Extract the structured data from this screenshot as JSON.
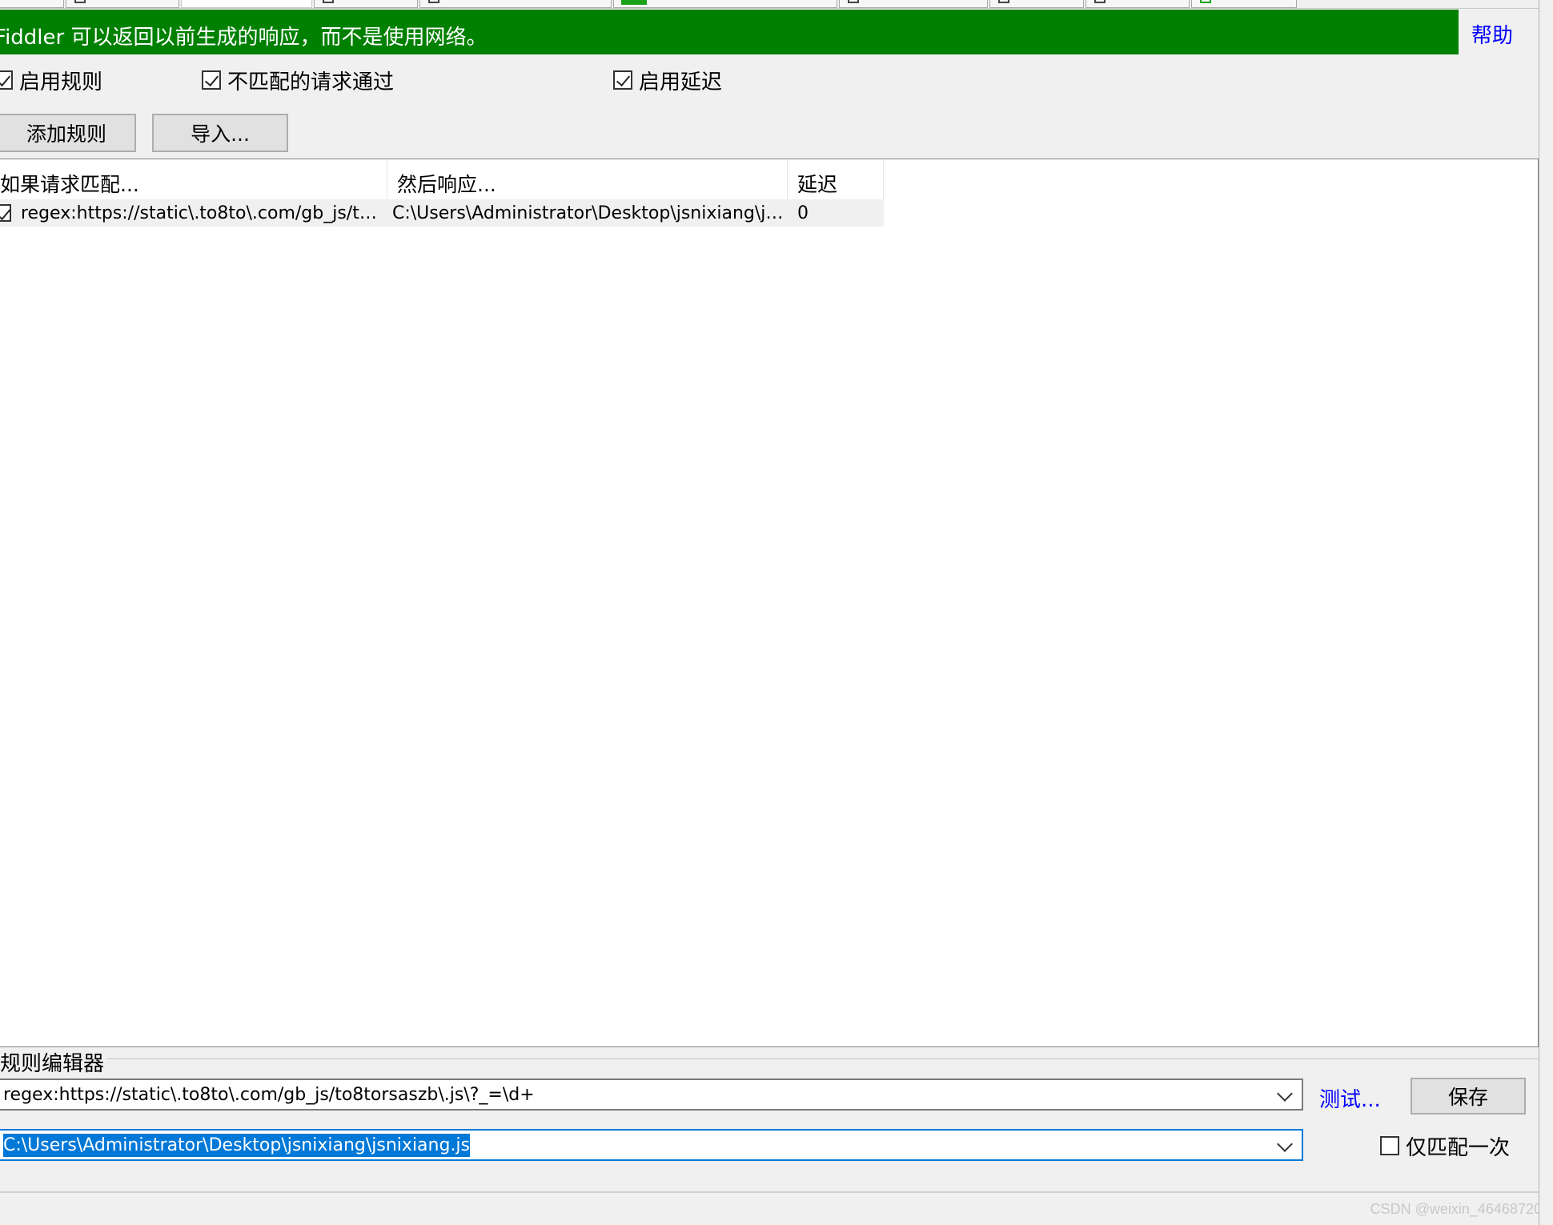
{
  "banner": {
    "message": "Fiddler 可以返回以前生成的响应，而不是使用网络。",
    "help_label": "帮助",
    "bg_color": "#008000"
  },
  "options": {
    "enable_rules": {
      "label": "启用规则",
      "checked": true
    },
    "unmatched_passthrough": {
      "label": "不匹配的请求通过",
      "checked": true
    },
    "enable_latency": {
      "label": "启用延迟",
      "checked": true
    }
  },
  "toolbar": {
    "add_rule_label": "添加规则",
    "import_label": "导入..."
  },
  "rules_table": {
    "columns": [
      "如果请求匹配...",
      "然后响应...",
      "延迟"
    ],
    "rows": [
      {
        "checked": true,
        "match": "regex:https://static\\.to8to\\.com/gb_js/to8t...",
        "action": "C:\\Users\\Administrator\\Desktop\\jsnixiang\\jsnix...",
        "latency": "0"
      }
    ]
  },
  "rule_editor": {
    "title": "规则编辑器",
    "match_value": "regex:https://static\\.to8to\\.com/gb_js/to8torsaszb\\.js\\?_=\\d+",
    "action_value": "C:\\Users\\Administrator\\Desktop\\jsnixiang\\jsnixiang.js",
    "test_label": "测试...",
    "save_label": "保存",
    "match_once": {
      "label": "仅匹配一次",
      "checked": false
    }
  },
  "watermark": "CSDN @weixin_46468720"
}
